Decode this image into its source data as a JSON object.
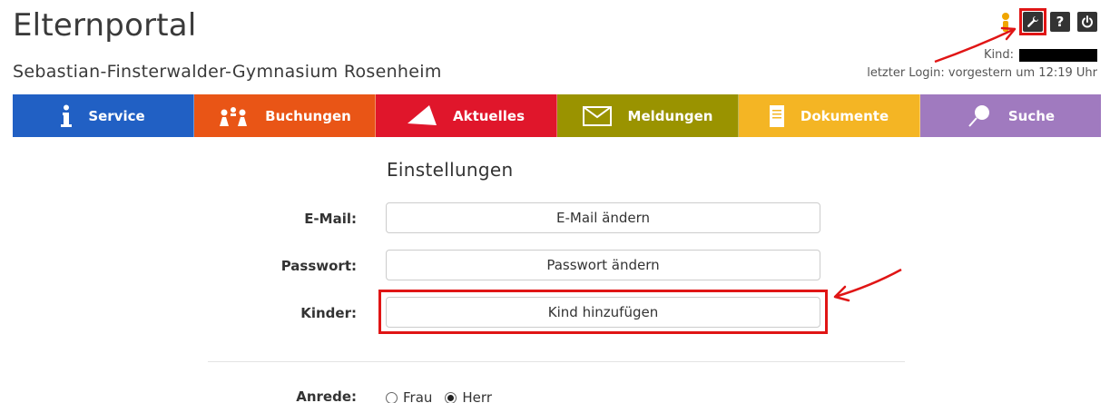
{
  "header": {
    "app_title": "Elternportal",
    "school_name": "Sebastian-Finsterwalder-Gymnasium Rosenheim",
    "kind_label": "Kind:",
    "last_login": "letzter Login: vorgestern um 12:19 Uhr",
    "icons": [
      "user-icon",
      "wrench-icon",
      "help-icon",
      "power-icon"
    ],
    "help_glyph": "?"
  },
  "nav": {
    "tabs": [
      {
        "label": "Service",
        "color": "#2160c4",
        "icon": "info-icon"
      },
      {
        "label": "Buchungen",
        "color": "#e95516",
        "icon": "people-icon"
      },
      {
        "label": "Aktuelles",
        "color": "#e0162b",
        "icon": "paper-plane-icon"
      },
      {
        "label": "Meldungen",
        "color": "#9a9300",
        "icon": "envelope-icon"
      },
      {
        "label": "Dokumente",
        "color": "#f4b524",
        "icon": "document-icon"
      },
      {
        "label": "Suche",
        "color": "#a07abf",
        "icon": "magnifier-icon"
      }
    ]
  },
  "settings": {
    "heading": "Einstellungen",
    "rows": [
      {
        "label": "E-Mail:",
        "button": "E-Mail ändern"
      },
      {
        "label": "Passwort:",
        "button": "Passwort ändern"
      },
      {
        "label": "Kinder:",
        "button": "Kind hinzufügen"
      }
    ],
    "anrede": {
      "label": "Anrede:",
      "options": [
        "Frau",
        "Herr"
      ],
      "selected": "Herr"
    }
  },
  "annotations": {
    "highlight_color": "#e01515"
  }
}
